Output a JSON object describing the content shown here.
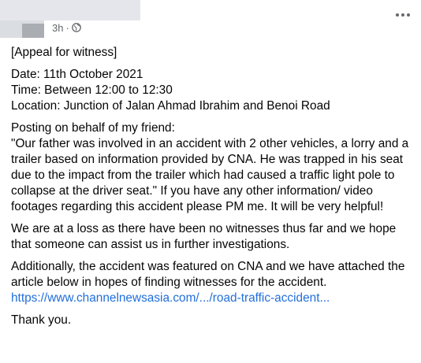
{
  "post": {
    "timestamp": "3h",
    "separator": "·",
    "privacy_icon": "globe-icon",
    "more_icon": "more-horizontal-icon",
    "paragraphs": {
      "p1": "[Appeal for witness]",
      "p2_line1": "Date: 11th October 2021",
      "p2_line2": "Time: Between 12:00 to 12:30",
      "p2_line3": "Location: Junction of Jalan Ahmad Ibrahim and Benoi Road",
      "p3_line1": "Posting on behalf of my friend:",
      "p3_rest": "\"Our father was involved in an accident with 2 other vehicles, a lorry and a trailer based on information provided by CNA. He was trapped in his seat due to the impact from the trailer which had caused a traffic light pole to collapse at the driver seat.\" If you have any other information/ video footages regarding this accident please PM me. It will be very helpful!",
      "p4": "We are at a loss as there have been no witnesses thus far and we hope that someone can assist us in further investigations.",
      "p5": "Additionally, the accident was featured on CNA and we have attached the article below in hopes of finding witnesses for the accident.",
      "link": "https://www.channelnewsasia.com/.../road-traffic-accident...",
      "p6": "Thank you."
    },
    "colors": {
      "text": "#050505",
      "meta": "#65676b",
      "link": "#216fdb"
    }
  }
}
